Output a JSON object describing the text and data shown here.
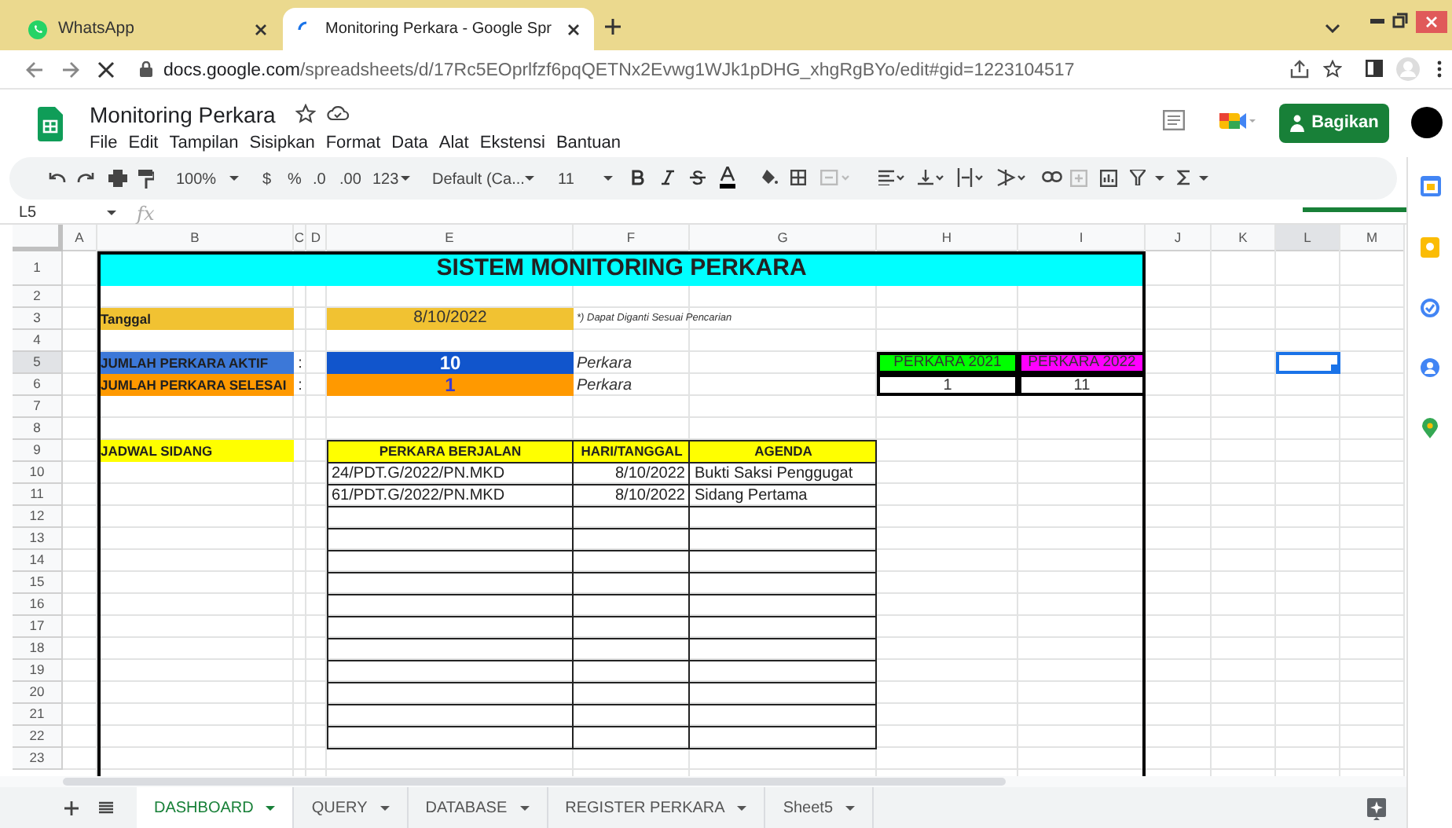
{
  "browser": {
    "tabs": [
      {
        "title": "WhatsApp",
        "kind": "chat",
        "selected": false
      },
      {
        "title": "Monitoring Perkara - Google Spr",
        "kind": "loading",
        "selected": true
      }
    ],
    "url_host": "docs.google.com",
    "url_path": "/spreadsheets/d/17Rc5EOprlfzf6pqQETNx2Evwg1WJk1pDHG_xhgRgBYo/edit#gid=1223104517"
  },
  "document": {
    "title": "Monitoring Perkara",
    "menu": [
      "File",
      "Edit",
      "Tampilan",
      "Sisipkan",
      "Format",
      "Data",
      "Alat",
      "Ekstensi",
      "Bantuan"
    ],
    "share_button": "Bagikan"
  },
  "toolbar": {
    "zoom": "100%",
    "currency": "$",
    "percent": "%",
    "decrease_decimals": ".0",
    "increase_decimals": ".00",
    "number_format": "123",
    "font": "Default (Ca...",
    "font_size": "11"
  },
  "formula_bar": {
    "name_box": "L5",
    "function_label": "fx"
  },
  "sheet": {
    "columns": [
      "A",
      "B",
      "C",
      "D",
      "E",
      "F",
      "G",
      "H",
      "I",
      "J",
      "K",
      "L",
      "M"
    ],
    "rows": [
      {
        "number": "1",
        "cells": {
          "B": {
            "kind": "title",
            "text": "SISTEM MONITORING PERKARA",
            "color": "#00ffff"
          }
        }
      },
      {
        "number": "2"
      },
      {
        "number": "3",
        "cells": {
          "B": {
            "kind": "label",
            "text": "Tanggal",
            "color": "#f1c232"
          },
          "E": {
            "kind": "value",
            "text": "8/10/2022",
            "color": "#f1c232"
          },
          "F": {
            "kind": "note",
            "text": "*) Dapat Diganti Sesuai Pencarian"
          }
        }
      },
      {
        "number": "4"
      },
      {
        "number": "5",
        "cells": {
          "B": {
            "kind": "label",
            "text": "JUMLAH PERKARA AKTIF",
            "color": "#3c78d8"
          },
          "C": {
            "kind": "plain",
            "text": ":"
          },
          "E": {
            "kind": "total",
            "text": "10",
            "color": "#1155cc"
          },
          "F": {
            "kind": "unit",
            "text": "Perkara"
          },
          "H": {
            "kind": "year_header",
            "text": "PERKARA 2021",
            "color": "#00ff00"
          },
          "I": {
            "kind": "year_header",
            "text": "PERKARA 2022",
            "color": "#ff00ff"
          }
        }
      },
      {
        "number": "6",
        "cells": {
          "B": {
            "kind": "label",
            "text": "JUMLAH PERKARA SELESAI",
            "color": "#ff9900"
          },
          "C": {
            "kind": "plain",
            "text": ":"
          },
          "E": {
            "kind": "total",
            "text": "1",
            "color": "#ff9900"
          },
          "F": {
            "kind": "unit",
            "text": "Perkara"
          },
          "H": {
            "kind": "year_count",
            "text": "1"
          },
          "I": {
            "kind": "year_count",
            "text": "11"
          }
        }
      },
      {
        "number": "7"
      },
      {
        "number": "8"
      },
      {
        "number": "9",
        "cells": {
          "B": {
            "kind": "label",
            "text": "JADWAL SIDANG",
            "color": "#ffff00"
          }
        }
      },
      {
        "number": "10"
      },
      {
        "number": "11"
      },
      {
        "number": "12"
      },
      {
        "number": "13"
      },
      {
        "number": "14"
      },
      {
        "number": "15"
      },
      {
        "number": "16"
      },
      {
        "number": "17"
      },
      {
        "number": "18"
      },
      {
        "number": "19"
      },
      {
        "number": "20"
      },
      {
        "number": "21"
      },
      {
        "number": "22"
      },
      {
        "number": "23"
      }
    ],
    "schedule": {
      "columns": [
        "PERKARA BERJALAN",
        "HARI/TANGGAL",
        "AGENDA"
      ],
      "rows": [
        [
          "24/PDT.G/2022/PN.MKD",
          "8/10/2022",
          "Bukti Saksi Penggugat"
        ],
        [
          "61/PDT.G/2022/PN.MKD",
          "8/10/2022",
          "Sidang Pertama"
        ]
      ]
    }
  },
  "sheet_tabs": [
    {
      "label": "DASHBOARD",
      "selected": true
    },
    {
      "label": "QUERY",
      "selected": false
    },
    {
      "label": "DATABASE",
      "selected": false
    },
    {
      "label": "REGISTER PERKARA",
      "selected": false
    },
    {
      "label": "Sheet5",
      "selected": false
    }
  ]
}
